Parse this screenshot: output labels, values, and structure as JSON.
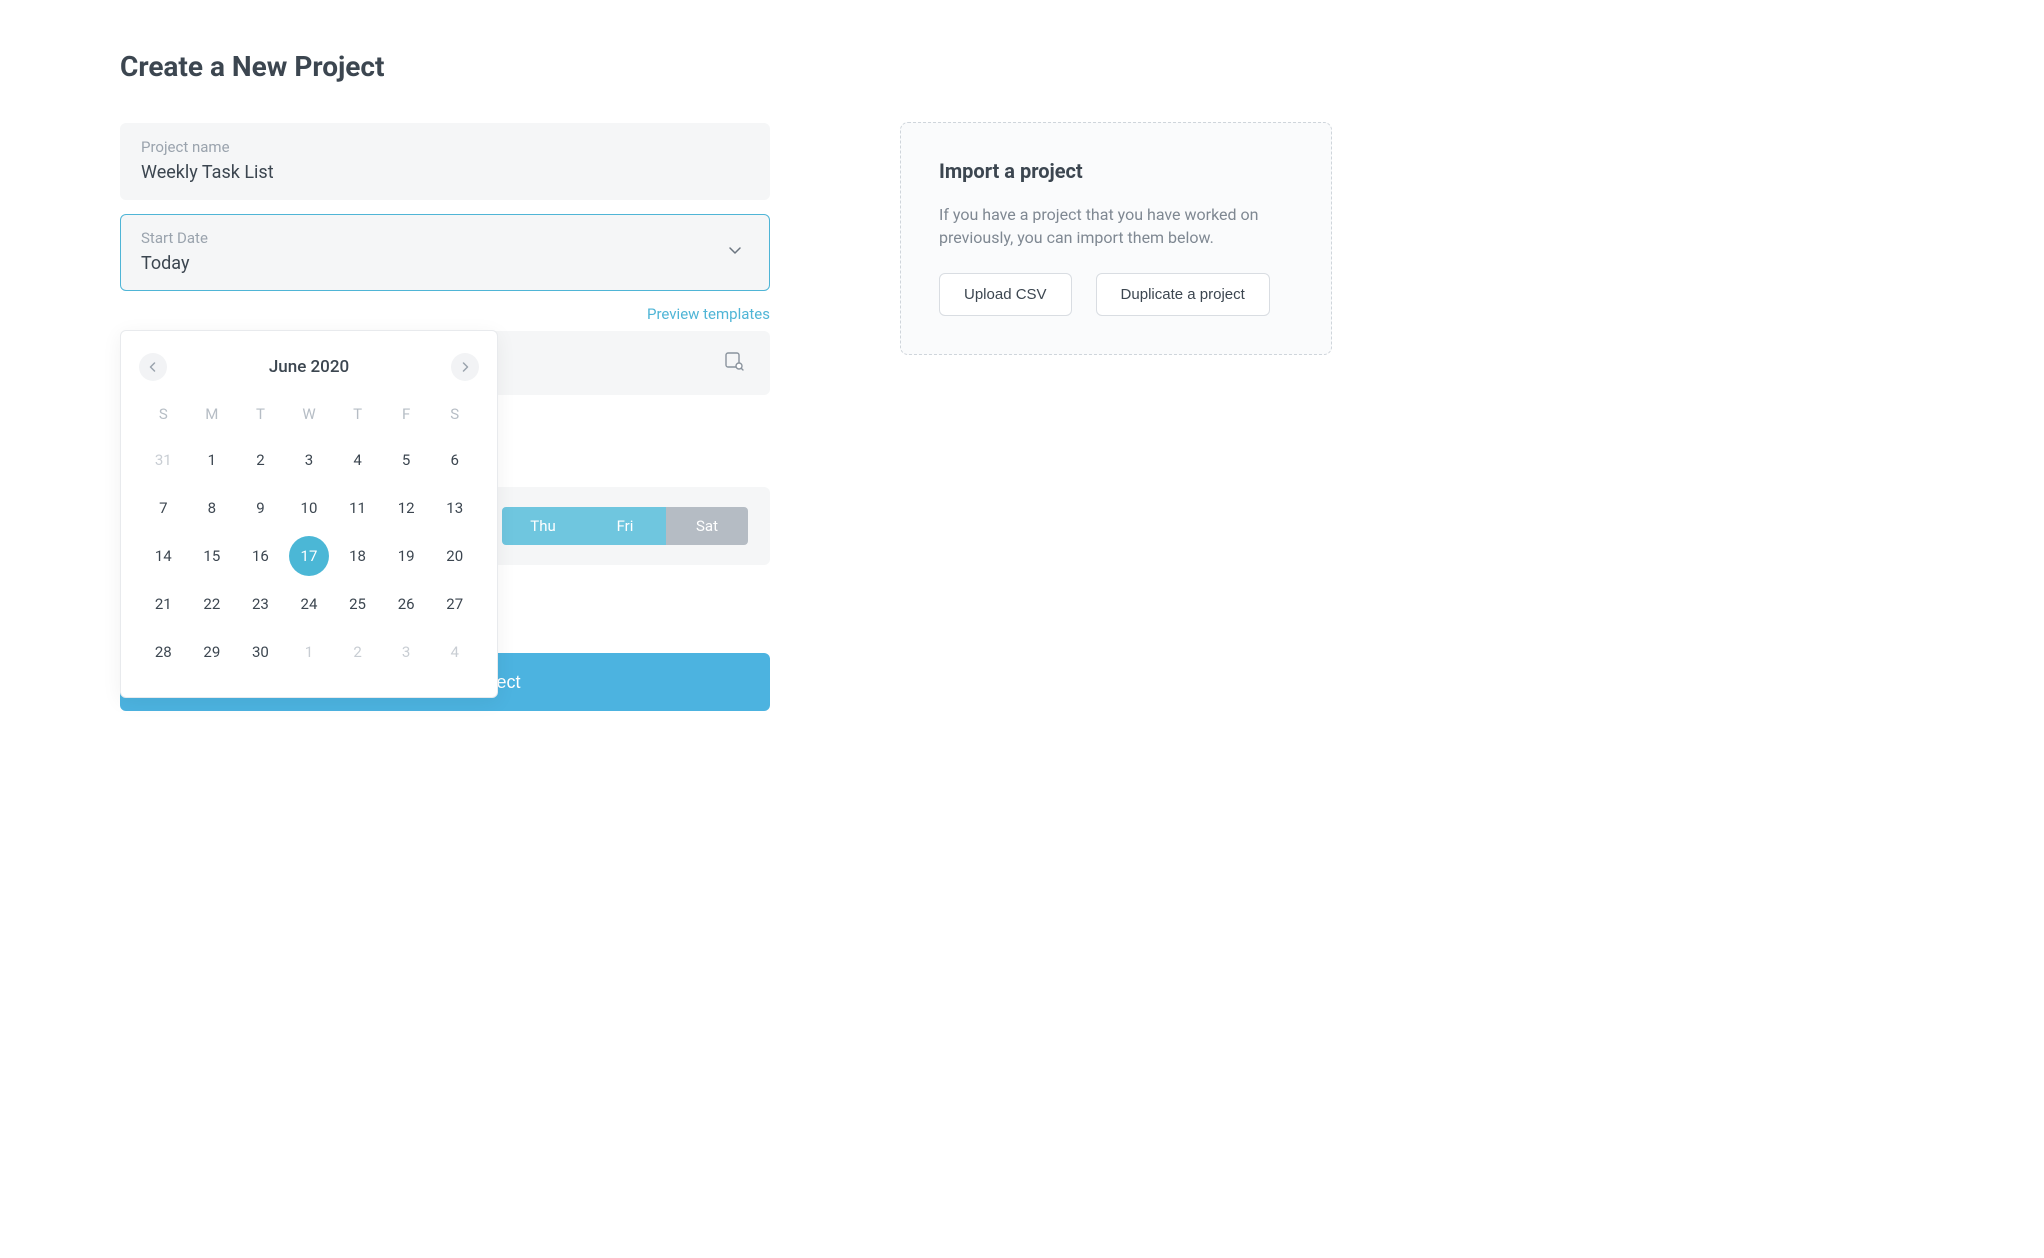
{
  "page_title": "Create a New Project",
  "project_name": {
    "label": "Project name",
    "value": "Weekly Task List"
  },
  "start_date": {
    "label": "Start Date",
    "value": "Today"
  },
  "calendar": {
    "month_label": "June 2020",
    "weekdays": [
      "S",
      "M",
      "T",
      "W",
      "T",
      "F",
      "S"
    ],
    "selected_day": 17,
    "weeks": [
      [
        {
          "d": "31",
          "o": true
        },
        {
          "d": "1"
        },
        {
          "d": "2"
        },
        {
          "d": "3"
        },
        {
          "d": "4"
        },
        {
          "d": "5"
        },
        {
          "d": "6"
        }
      ],
      [
        {
          "d": "7"
        },
        {
          "d": "8"
        },
        {
          "d": "9"
        },
        {
          "d": "10"
        },
        {
          "d": "11"
        },
        {
          "d": "12"
        },
        {
          "d": "13"
        }
      ],
      [
        {
          "d": "14"
        },
        {
          "d": "15"
        },
        {
          "d": "16"
        },
        {
          "d": "17",
          "sel": true
        },
        {
          "d": "18"
        },
        {
          "d": "19"
        },
        {
          "d": "20"
        }
      ],
      [
        {
          "d": "21"
        },
        {
          "d": "22"
        },
        {
          "d": "23"
        },
        {
          "d": "24"
        },
        {
          "d": "25"
        },
        {
          "d": "26"
        },
        {
          "d": "27"
        }
      ],
      [
        {
          "d": "28"
        },
        {
          "d": "29"
        },
        {
          "d": "30"
        },
        {
          "d": "1",
          "o": true
        },
        {
          "d": "2",
          "o": true
        },
        {
          "d": "3",
          "o": true
        },
        {
          "d": "4",
          "o": true
        }
      ]
    ]
  },
  "preview_templates_label": "Preview templates",
  "work_days": [
    {
      "label": "Thu",
      "active": true
    },
    {
      "label": "Fri",
      "active": true
    },
    {
      "label": "Sat",
      "active": false
    }
  ],
  "create_button_label": "Create new project",
  "import": {
    "title": "Import a project",
    "description": "If you have a project that you have worked on previously, you can import them below.",
    "upload_csv_label": "Upload CSV",
    "duplicate_label": "Duplicate a project"
  }
}
